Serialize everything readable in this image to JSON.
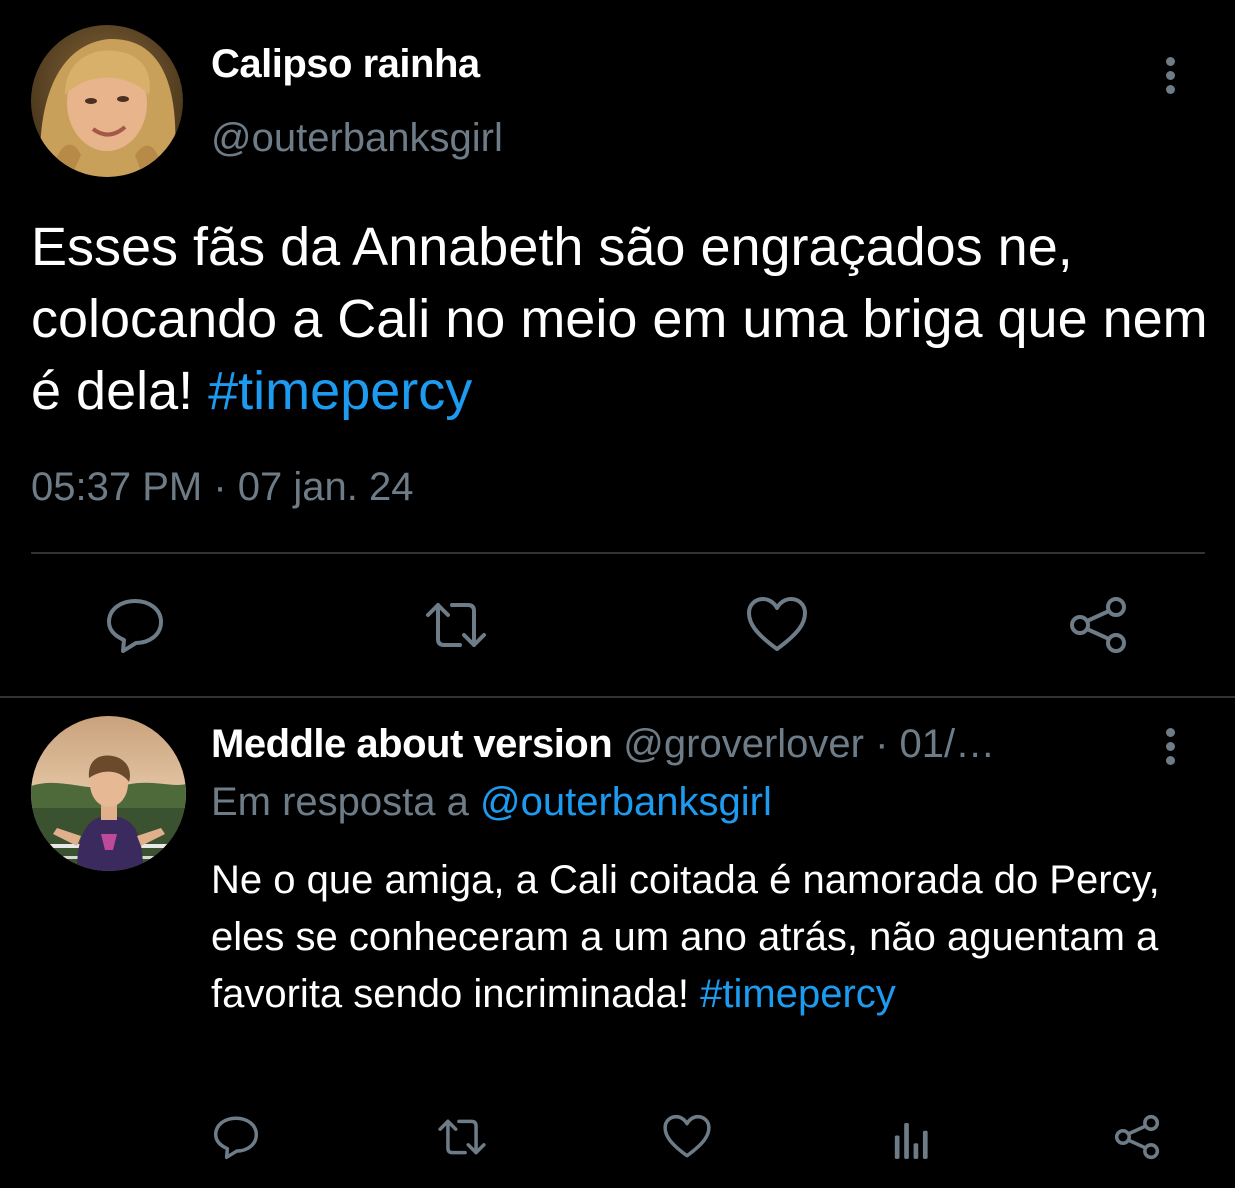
{
  "main_tweet": {
    "display_name": "Calipso rainha",
    "handle": "@outerbanksgirl",
    "text_before_hashtag": "Esses fãs da Annabeth são engraçados ne, colocando a Cali no meio em uma briga que nem é dela! ",
    "hashtag": "#timepercy",
    "timestamp": "05:37 PM · 07 jan. 24",
    "actions": [
      "reply-icon",
      "retweet-icon",
      "like-icon",
      "share-icon"
    ]
  },
  "reply_tweet": {
    "display_name": "Meddle about version",
    "handle": "@groverlover",
    "date": " · 01/…",
    "reply_prefix": "Em resposta a ",
    "reply_to_handle": "@outerbanksgirl",
    "text_before_hashtag": "Ne o que amiga, a Cali coitada é namorada do Percy, eles se conheceram a um ano atrás, não aguentam a favorita sendo incriminada! ",
    "hashtag": "#timepercy",
    "actions": [
      "reply-icon",
      "retweet-icon",
      "like-icon",
      "stats-icon",
      "share-icon"
    ]
  },
  "colors": {
    "background": "#000000",
    "text": "#ffffff",
    "muted": "#6e7c88",
    "link": "#1d9bf0",
    "divider": "#2f3336"
  }
}
